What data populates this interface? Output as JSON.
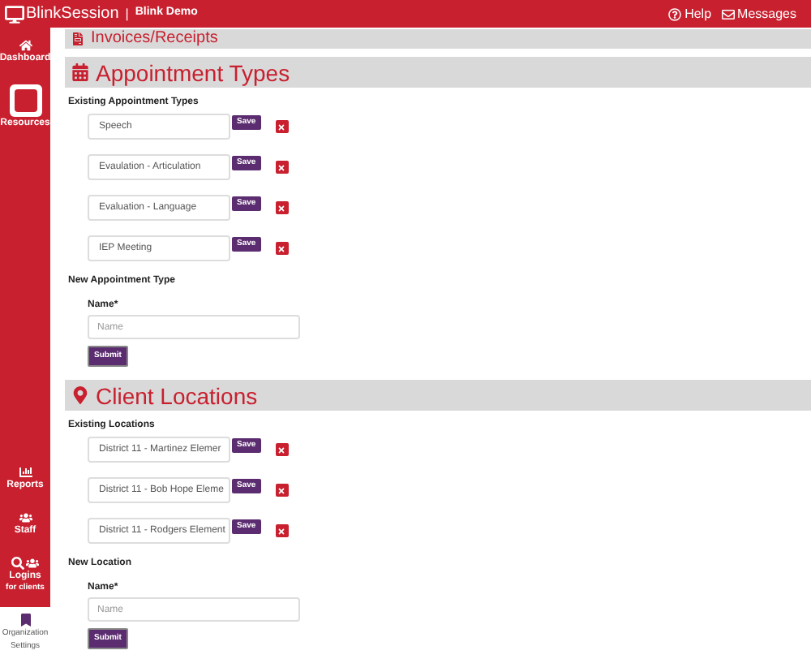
{
  "header": {
    "brand": "BlinkSession",
    "separator": "|",
    "org": "Blink Demo",
    "links": [
      {
        "kind": "help",
        "label": "Help"
      },
      {
        "kind": "messages",
        "label": "Messages"
      }
    ]
  },
  "sidebar": {
    "items": [
      {
        "kind": "home",
        "label": "Dashboard",
        "selected": false
      },
      {
        "kind": "resources",
        "label": "Resources",
        "selected": false
      },
      {
        "kind": "reports",
        "label": "Reports",
        "selected": false
      },
      {
        "kind": "staff",
        "label": "Staff",
        "selected": false
      },
      {
        "kind": "logins",
        "label": "Logins",
        "sublabel": "for clients",
        "selected": false
      },
      {
        "kind": "org",
        "label": "Organization Settings",
        "selected": true
      }
    ]
  },
  "sections": [
    {
      "kind": "invoices",
      "title": "Invoices/Receipts"
    },
    {
      "kind": "calendar",
      "title": "Appointment Types",
      "existing_label": "Existing Appointment Types",
      "items": [
        {
          "value": "Speech",
          "save": "Save"
        },
        {
          "value": "Evaulation - Articulation",
          "save": "Save"
        },
        {
          "value": "Evaluation - Language",
          "save": "Save"
        },
        {
          "value": "IEP Meeting",
          "save": "Save"
        }
      ],
      "new_label": "New Appointment Type",
      "name_label": "Name*",
      "placeholder": "Name",
      "submit": "Submit"
    },
    {
      "kind": "pin",
      "title": "Client Locations",
      "existing_label": "Existing Locations",
      "items": [
        {
          "value": "District 11 - Martinez Elemer",
          "save": "Save"
        },
        {
          "value": "District 11 - Bob Hope Eleme",
          "save": "Save"
        },
        {
          "value": "District 11 - Rodgers Element",
          "save": "Save"
        }
      ],
      "new_label": "New Location",
      "name_label": "Name*",
      "placeholder": "Name",
      "submit": "Submit"
    }
  ]
}
